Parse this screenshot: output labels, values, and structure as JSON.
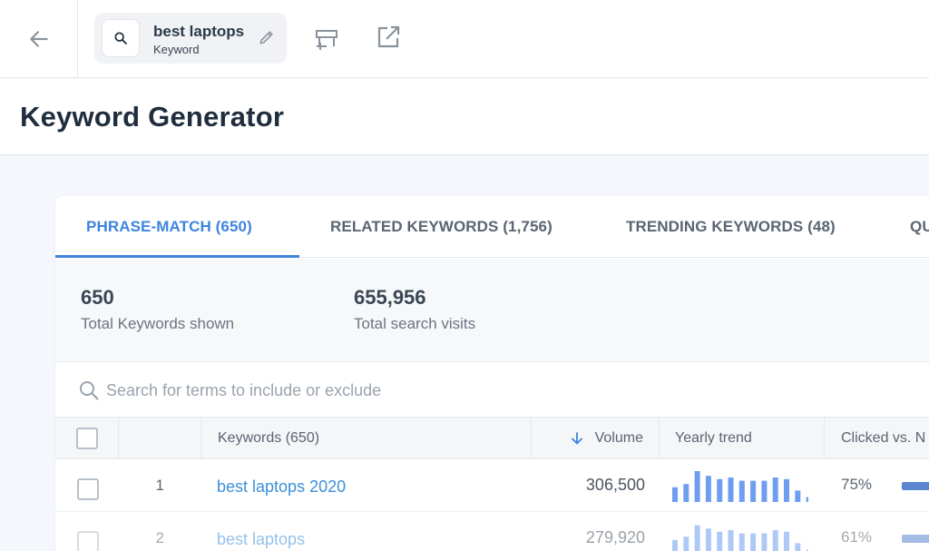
{
  "topbar": {
    "search_chip": {
      "keyword": "best laptops",
      "type": "Keyword"
    }
  },
  "page": {
    "title": "Keyword Generator"
  },
  "tabs": [
    {
      "label": "PHRASE-MATCH (650)",
      "active": true
    },
    {
      "label": "RELATED KEYWORDS (1,756)",
      "active": false
    },
    {
      "label": "TRENDING KEYWORDS (48)",
      "active": false
    },
    {
      "label": "QU",
      "active": false
    }
  ],
  "stats": [
    {
      "value": "650",
      "label": "Total Keywords shown"
    },
    {
      "value": "655,956",
      "label": "Total search visits"
    }
  ],
  "search": {
    "placeholder": "Search for terms to include or exclude",
    "value": ""
  },
  "table": {
    "columns": {
      "keywords": "Keywords (650)",
      "volume": "Volume",
      "trend": "Yearly trend",
      "clicked": "Clicked vs. N"
    },
    "rows": [
      {
        "index": "1",
        "keyword": "best laptops 2020",
        "volume": "306,500",
        "clicked": "75%",
        "trend": [
          0.45,
          0.55,
          0.95,
          0.8,
          0.7,
          0.75,
          0.65,
          0.65,
          0.65,
          0.75,
          0.7,
          0.35,
          0.15
        ]
      },
      {
        "index": "2",
        "keyword": "best laptops",
        "volume": "279,920",
        "clicked": "61%",
        "trend": [
          0.45,
          0.55,
          0.9,
          0.8,
          0.7,
          0.75,
          0.65,
          0.65,
          0.65,
          0.75,
          0.7,
          0.35,
          0.15
        ]
      }
    ]
  },
  "colors": {
    "accent": "#3d84e0",
    "link": "#3d8fd8",
    "trend_bar": "#6f9ef0",
    "clicked_bar": "#5b86cf"
  }
}
